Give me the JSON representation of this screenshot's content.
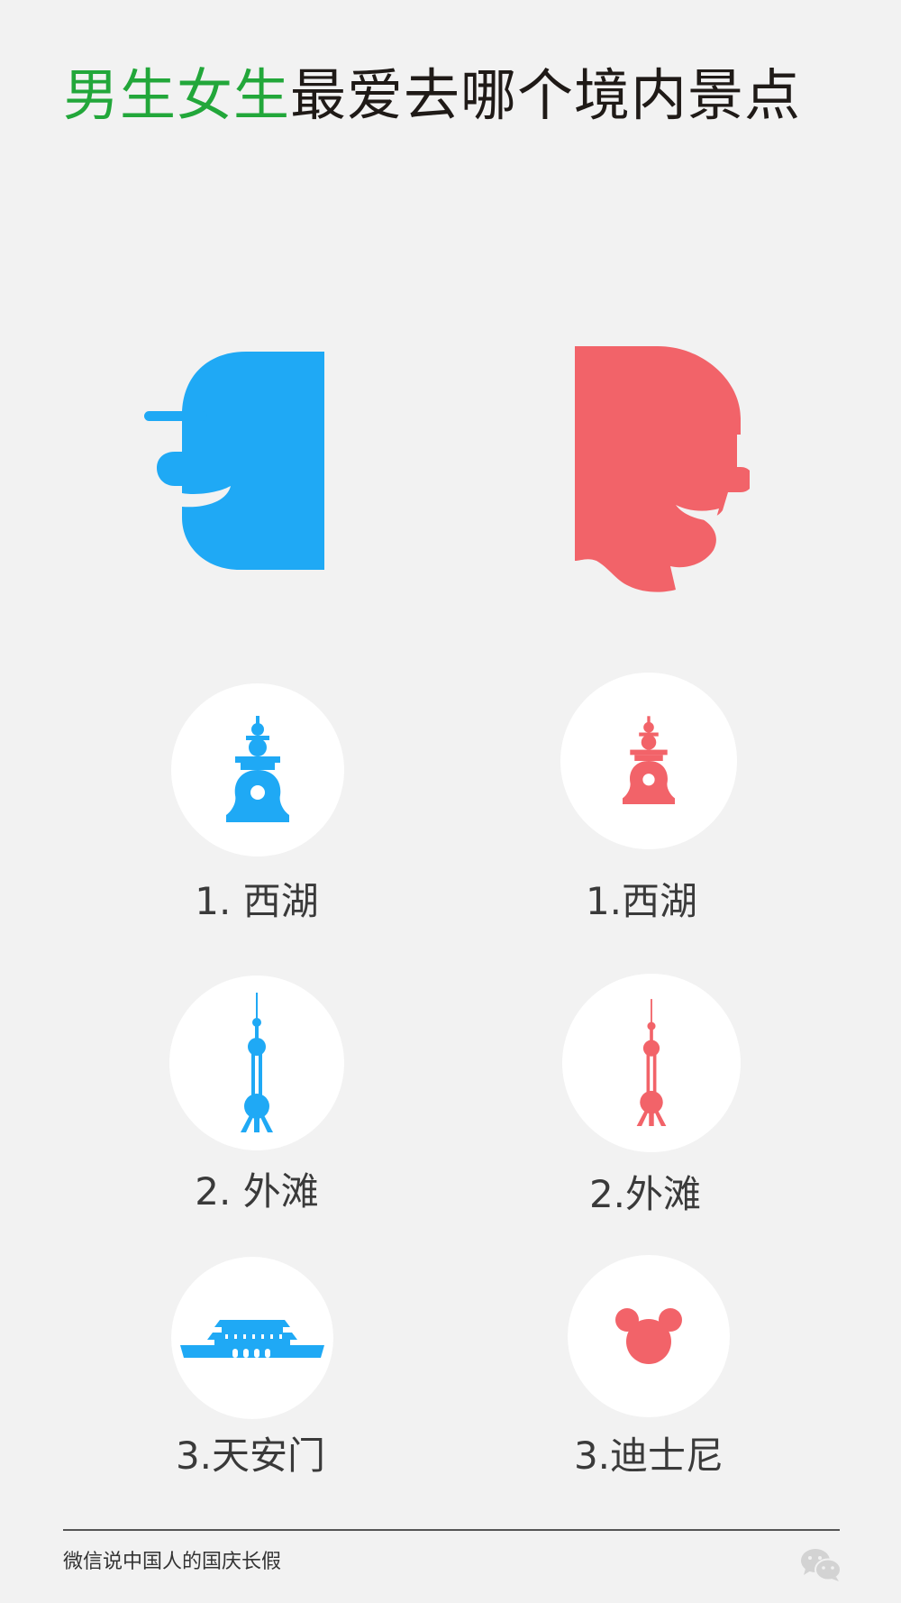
{
  "title": {
    "highlight": "男生女生",
    "rest": "最爱去哪个境内景点"
  },
  "colors": {
    "male": "#1fa9f5",
    "female": "#f26369",
    "highlight": "#22a73a"
  },
  "male": {
    "avatar_icon": "male-head-with-cap",
    "items": [
      {
        "label": "1. 西湖",
        "icon": "pagoda-icon"
      },
      {
        "label": "2. 外滩",
        "icon": "tv-tower-icon"
      },
      {
        "label": "3.天安门",
        "icon": "gate-tower-icon"
      }
    ]
  },
  "female": {
    "avatar_icon": "female-head-with-hair",
    "items": [
      {
        "label": "1.西湖",
        "icon": "pagoda-icon"
      },
      {
        "label": "2.外滩",
        "icon": "tv-tower-icon"
      },
      {
        "label": "3.迪士尼",
        "icon": "mouse-ears-icon"
      }
    ]
  },
  "footer": {
    "text": "微信说中国人的国庆长假",
    "logo": "wechat-icon"
  }
}
